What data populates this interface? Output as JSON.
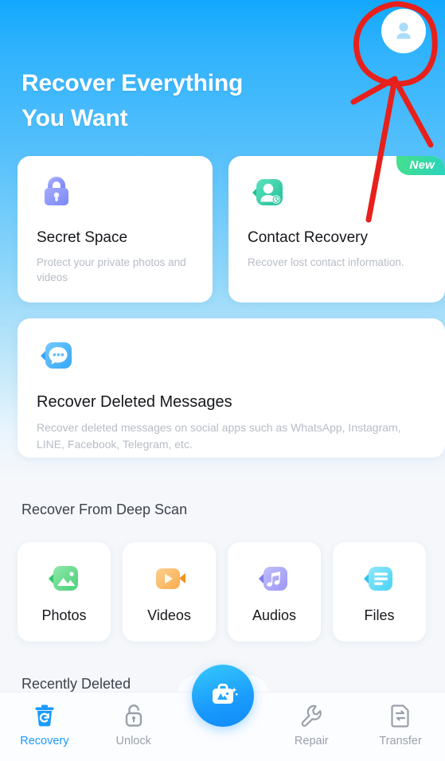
{
  "header": {
    "title": "Recover Everything\nYou Want",
    "avatar_icon": "user-avatar-icon"
  },
  "feature_cards": [
    {
      "icon": "lock-icon",
      "title": "Secret Space",
      "subtitle": "Protect your private photos and videos",
      "badge": null
    },
    {
      "icon": "contact-recovery-icon",
      "title": "Contact Recovery",
      "subtitle": "Recover lost contact information.",
      "badge": "New"
    }
  ],
  "message_card": {
    "icon": "message-bubble-icon",
    "title": "Recover Deleted Messages",
    "subtitle": "Recover deleted messages on social apps such as WhatsApp, Instagram, LINE, Facebook, Telegram, etc."
  },
  "deep_scan": {
    "section_title": "Recover From Deep Scan",
    "tiles": [
      {
        "icon": "photos-icon",
        "label": "Photos"
      },
      {
        "icon": "videos-icon",
        "label": "Videos"
      },
      {
        "icon": "audios-icon",
        "label": "Audios"
      },
      {
        "icon": "files-icon",
        "label": "Files"
      }
    ]
  },
  "recently_deleted": {
    "section_title": "Recently Deleted"
  },
  "bottom_nav": {
    "items": [
      {
        "icon": "recovery-trash-icon",
        "label": "Recovery",
        "active": true
      },
      {
        "icon": "unlock-padlock-icon",
        "label": "Unlock",
        "active": false
      },
      {
        "icon": "ai-toolbox-icon",
        "label": "",
        "active": false
      },
      {
        "icon": "repair-wrench-icon",
        "label": "Repair",
        "active": false
      },
      {
        "icon": "transfer-document-icon",
        "label": "Transfer",
        "active": false
      }
    ],
    "fab_icon": "ai-toolbox-icon"
  },
  "annotation": {
    "type": "hand-drawn-red-arrow",
    "target": "user-avatar-icon",
    "color": "#e8201b"
  },
  "colors": {
    "header_gradient_top": "#12a8fd",
    "header_gradient_bottom": "#f5f7fa",
    "page_background": "#f5f7fa",
    "accent_blue": "#1a9bfc",
    "badge_green": "#46e08b",
    "badge_teal": "#2ad4c0",
    "title_text": "#16181c",
    "muted_text": "#b7bcc6",
    "nav_inactive": "#9aa0aa"
  }
}
